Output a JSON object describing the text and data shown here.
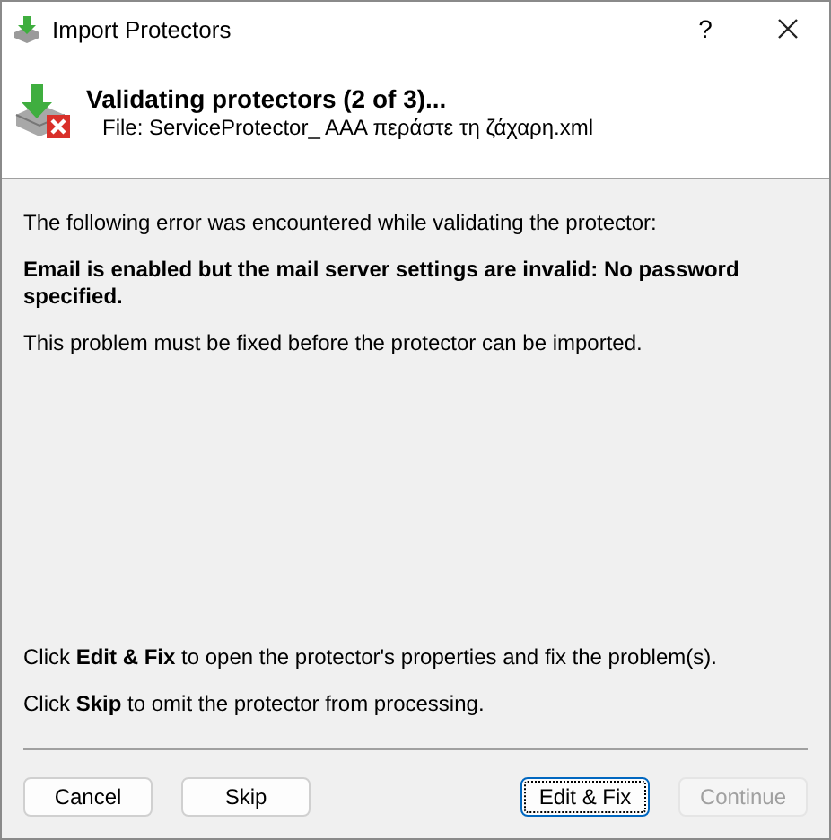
{
  "window": {
    "title": "Import Protectors",
    "help": "?"
  },
  "header": {
    "title": "Validating protectors (2 of 3)...",
    "file": "File: ServiceProtector_ AAA περάστε τη ζάχαρη.xml"
  },
  "message": {
    "intro": "The following error was encountered while validating the protector:",
    "error": "Email is enabled but the mail server settings are invalid: No password specified.",
    "note": "This problem must be fixed before the protector can be imported."
  },
  "instructions": [
    "Click **Edit & Fix** to open the protector's properties and fix the problem(s).",
    "Click **Skip** to omit the protector from processing."
  ],
  "buttons_left": [
    {
      "label": "Cancel",
      "focused": false,
      "disabled": false
    },
    {
      "label": "Skip",
      "focused": false,
      "disabled": false
    }
  ],
  "buttons_right": [
    {
      "label": "Edit & Fix",
      "focused": true,
      "disabled": false
    },
    {
      "label": "Continue",
      "focused": false,
      "disabled": true
    }
  ]
}
